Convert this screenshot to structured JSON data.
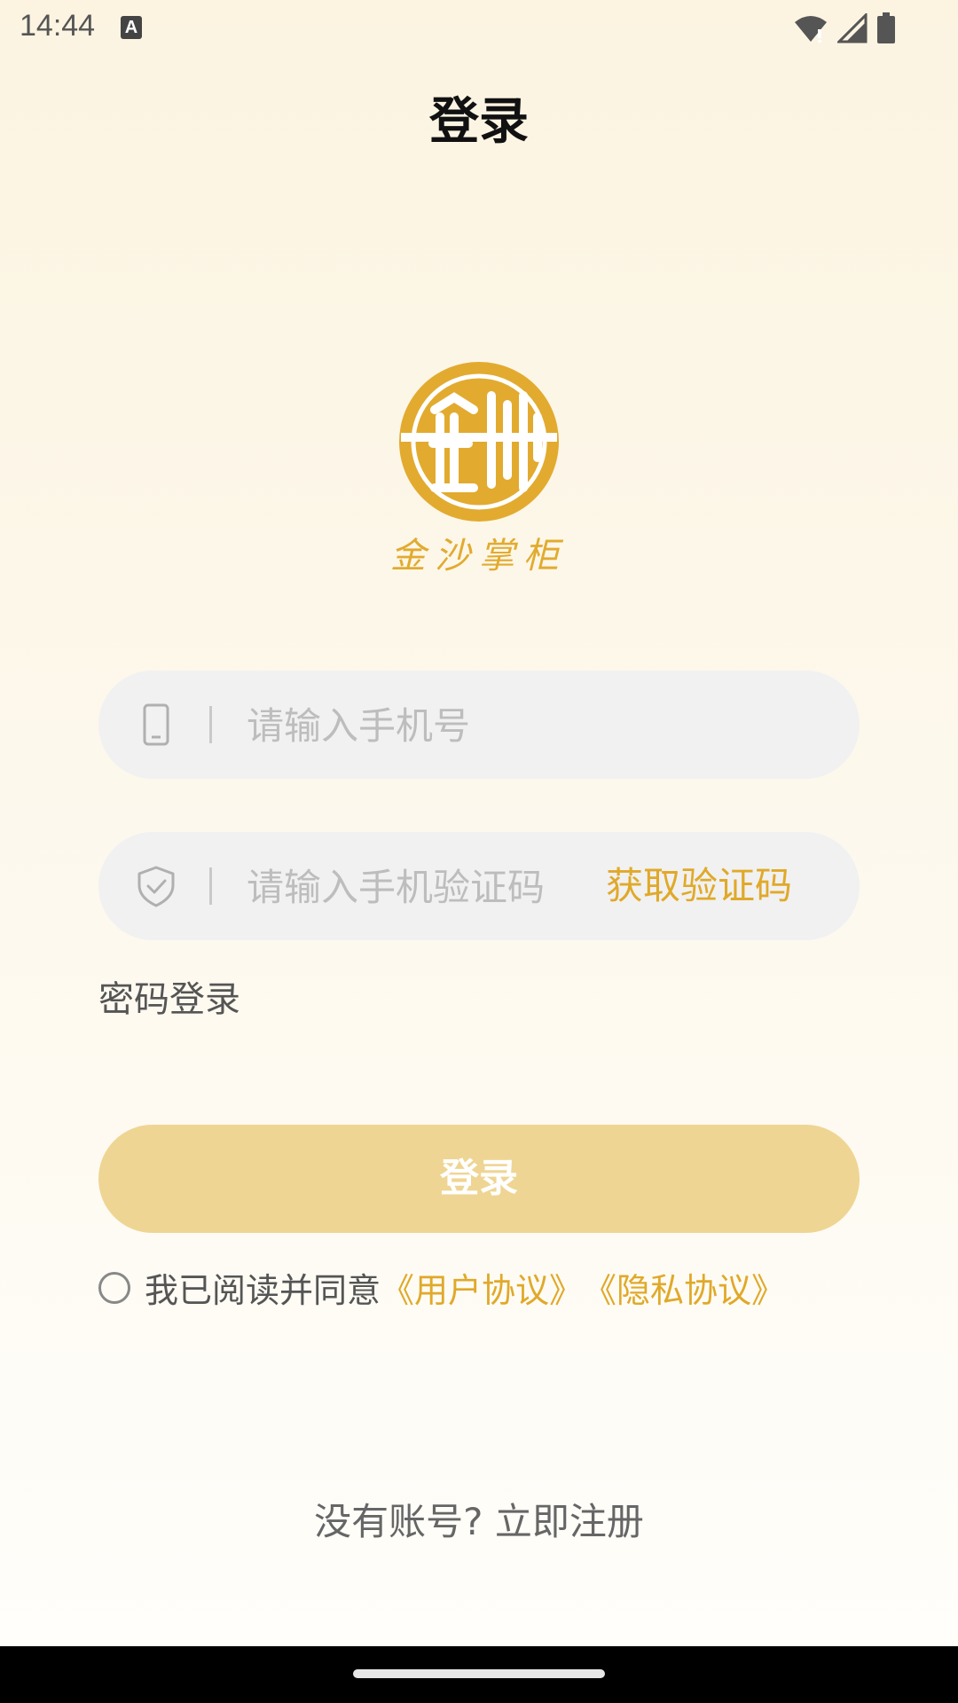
{
  "status_bar": {
    "time": "14:44",
    "badge": "A"
  },
  "header": {
    "title": "登录"
  },
  "logo": {
    "text": "金沙掌柜",
    "color": "#e2ab2f"
  },
  "phone": {
    "placeholder": "请输入手机号"
  },
  "code": {
    "placeholder": "请输入手机验证码",
    "get_code_label": "获取验证码"
  },
  "password_login_label": "密码登录",
  "login_button_label": "登录",
  "agreement": {
    "prefix": "我已阅读并同意",
    "user_agreement": "《用户协议》",
    "privacy_policy": "《隐私协议》",
    "checked": false
  },
  "register_label": "没有账号? 立即注册",
  "colors": {
    "accent": "#e0a92a",
    "button": "#efd593",
    "field_bg": "#f1f1f1"
  }
}
